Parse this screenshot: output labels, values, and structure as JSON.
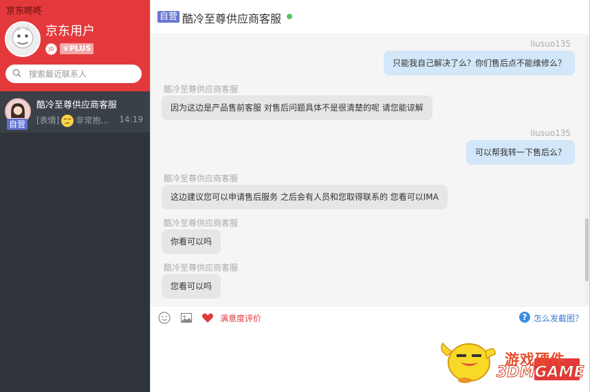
{
  "app": {
    "title": "京东咚咚"
  },
  "profile": {
    "name": "京东用户",
    "level_badge": "J0",
    "plus_badge": "PLUS"
  },
  "search": {
    "placeholder": "搜索最近联系人"
  },
  "contacts": [
    {
      "tag": "自营",
      "name": "酷冷至尊供应商客服",
      "preview_prefix": "[表情]",
      "preview_text": "非常抱...",
      "time": "14:19"
    }
  ],
  "chat": {
    "header_tag": "自营",
    "title": "酷冷至尊供应商客服",
    "online_color": "#5cc466",
    "messages": [
      {
        "side": "right",
        "sender": "liusuo135",
        "text": "只能我自己解决了么？你们售后点不能维修么？"
      },
      {
        "side": "left",
        "sender": "酷冷至尊供应商客服",
        "text": "因为这边是产品售前客服 对售后问题具体不是很清楚的呢 请您能谅解"
      },
      {
        "side": "right",
        "sender": "liusuo135",
        "text": "可以帮我转一下售后么？"
      },
      {
        "side": "left",
        "sender": "酷冷至尊供应商客服",
        "text": "这边建议您可以申请售后服务 之后会有人员和您取得联系的 您看可以IMA"
      },
      {
        "side": "left",
        "sender": "酷冷至尊供应商客服",
        "text": "你看可以吗"
      },
      {
        "side": "left",
        "sender": "酷冷至尊供应商客服",
        "text": "您看可以吗"
      }
    ]
  },
  "toolbar": {
    "emoji_icon": "smiley-icon",
    "image_icon": "image-icon",
    "rate_icon": "heart-icon",
    "rate_label": "满意度评价",
    "help_icon": "question-icon",
    "help_label": "怎么发截图？"
  },
  "watermark": {
    "line1": "游戏硬件",
    "line2": "3DMGAME"
  },
  "colors": {
    "brand_red": "#e4393c",
    "sidebar_dark": "#2f343b",
    "bubble_right": "#d2e7f9",
    "bubble_left": "#e6e6e6",
    "tag_blue": "#6676cf"
  }
}
